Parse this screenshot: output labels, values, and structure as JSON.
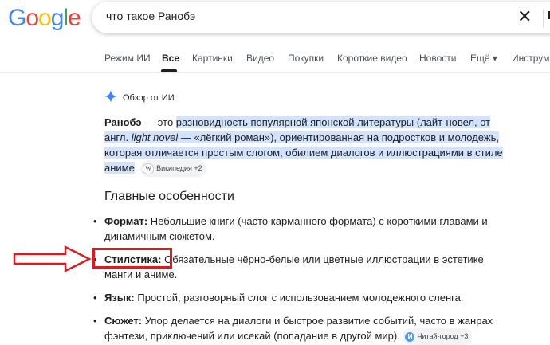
{
  "logo": {
    "letters": [
      "G",
      "o",
      "o",
      "g",
      "l",
      "e"
    ],
    "colors": [
      "#4285F4",
      "#EA4335",
      "#FBBC05",
      "#4285F4",
      "#34A853",
      "#EA4335"
    ]
  },
  "search": {
    "value": "что такое Ранобэ",
    "clear_icon": "close-icon",
    "partial_right": "Е"
  },
  "tabs": [
    {
      "label": "Режим ИИ"
    },
    {
      "label": "Все",
      "active": true
    },
    {
      "label": "Картинки"
    },
    {
      "label": "Видео"
    },
    {
      "label": "Покупки"
    },
    {
      "label": "Короткие видео"
    },
    {
      "label": "Новости"
    },
    {
      "label": "Ещё ▾"
    },
    {
      "label": "Инструме"
    }
  ],
  "overview": {
    "label": "Обзор от ИИ",
    "icon": "sparkle-icon"
  },
  "intro": {
    "term": "Ранобэ",
    "dash": " — это ",
    "highlight1": "разновидность популярной японской литературы (лайт-новел, от англ. ",
    "light_novel": "light novel",
    "highlight2": " — «лёгкий роман»), ориентированная на подростков и молодежь, которая отличается простым слогом, обилием диалогов и иллюстрациями в стиле аниме",
    "period": ".",
    "source_chip": "Википедия +2"
  },
  "features": {
    "heading": "Главные особенности",
    "items": [
      {
        "title": "Формат:",
        "text": " Небольшие книги (часто карманного формата) с короткими главами и динамичным сюжетом."
      },
      {
        "title": "Стилстика:",
        "text": " Обязательные чёрно-белые или цветные иллюстрации в эстетике манги и аниме."
      },
      {
        "title": "Язык:",
        "text": " Простой, разговорный слог с использованием молодежного сленга."
      },
      {
        "title": "Сюжет:",
        "text": " Упор делается на диалоги и быстрое развитие событий, часто в жанрах фэнтези, приключений или исекай (попадание в другой мир).",
        "chip": "Читай-город +3"
      }
    ]
  },
  "annotation": {
    "arrow_color": "#e0191d",
    "box_color": "#e0191d"
  }
}
